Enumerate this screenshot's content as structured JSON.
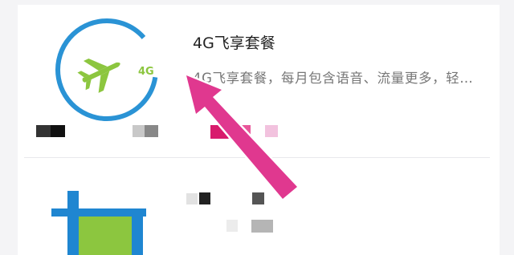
{
  "plan": {
    "title": "4G飞享套餐",
    "description": "4G飞享套餐，每月包含语音、流量更多，轻…",
    "logo_badge": "4G"
  },
  "icons": {
    "plan_logo": "airplane-icon",
    "second_logo": "square-frame-icon",
    "annotation": "arrow-icon"
  },
  "colors": {
    "ring_blue": "#2a93d5",
    "plane_green": "#8cc63f",
    "arrow_pink": "#e0388f",
    "second_logo_blue": "#1f86d1",
    "second_logo_green": "#8cc63f"
  }
}
